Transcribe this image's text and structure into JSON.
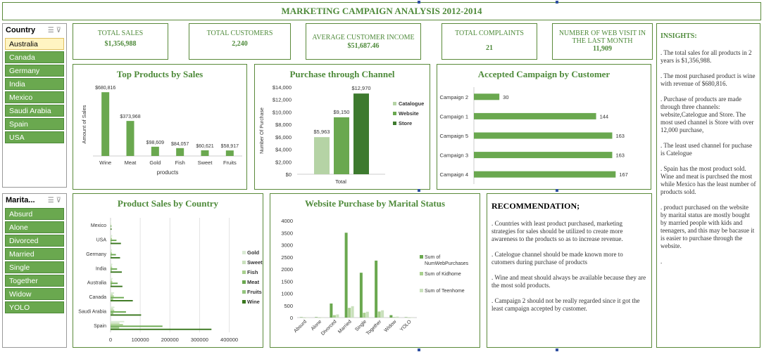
{
  "title": "MARKETING CAMPAIGN ANALYSIS 2012-2014",
  "kpis": [
    {
      "label": "TOTAL SALES",
      "value": "$1,356,988"
    },
    {
      "label": "TOTAL CUSTOMERS",
      "value": "2,240"
    },
    {
      "label": "AVERAGE CUSTOMER INCOME",
      "value": "$51,687.46"
    },
    {
      "label": "TOTAL COMPLAINTS",
      "value": "21"
    },
    {
      "label": "NUMBER OF WEB VISIT IN THE LAST MONTH",
      "value": "11,909"
    }
  ],
  "country_slicer": {
    "header": "Country",
    "items": [
      "Australia",
      "Canada",
      "Germany",
      "India",
      "Mexico",
      "Saudi Arabia",
      "Spain",
      "USA"
    ],
    "selected": "Australia"
  },
  "marital_slicer": {
    "header": "Marita...",
    "items": [
      "Absurd",
      "Alone",
      "Divorced",
      "Married",
      "Single",
      "Together",
      "Widow",
      "YOLO"
    ]
  },
  "insights": {
    "heading": "INSIGHTS:",
    "paragraphs": [
      ". The total sales for all products in 2 years is $1,356,988.",
      ". The most purchased product is wine with revenue of $680,816.",
      ". Purchase of products are made through three channels: website,Catelogue and Store. The most used channel is Store with over 12,000 purchase,",
      ". The least used channel for puchase is Catelogue",
      ". Spain has the most product sold. Wine and meat is purchsed the most while Mexico has the least number of products sold.",
      ". product purchased on the website by marital status are mostly bought by married people with kids and teenagers, and this may be bacasue it is easier to purchase through the website.",
      "."
    ]
  },
  "recommendation": {
    "heading": "RECOMMENDATION;",
    "paragraphs": [
      ". Countries with least product purchased, marketing strategies for sales should be utilized to create more awareness to the products so as to increase revenue.",
      ". Catelogue channel should be made known more to cutomers during purchase of products",
      ". Wine and meat should always be available because they are the most sold products.",
      ". Campaign 2 should not be really regarded since it got the least campaign accepted by customer."
    ]
  },
  "colors": {
    "accent": "#4e8a3a",
    "bar": "#6aa84f",
    "dark": "#3d7a2e",
    "light": "#b5d3a5"
  },
  "chart_data": [
    {
      "type": "bar",
      "title": "Top Products by Sales",
      "categories": [
        "Wine",
        "Meat",
        "Gold",
        "Fish",
        "Sweet",
        "Fruits"
      ],
      "values": [
        680816,
        373968,
        98609,
        84057,
        60621,
        58917
      ],
      "value_labels": [
        "$680,816",
        "$373,968",
        "$98,609",
        "$84,057",
        "$60,621",
        "$58,917"
      ],
      "xlabel": "products",
      "ylabel": "Amount of Sales",
      "ylim": [
        0,
        750000
      ]
    },
    {
      "type": "bar",
      "title": "Purchase through Channel",
      "categories": [
        "Total"
      ],
      "series": [
        {
          "name": "Catalogue",
          "values": [
            5963
          ],
          "label": "$5,963"
        },
        {
          "name": "Website",
          "values": [
            9150
          ],
          "label": "$9,150"
        },
        {
          "name": "Store",
          "values": [
            12970
          ],
          "label": "$12,970"
        }
      ],
      "ylabel": "Number Of Purchase",
      "yticks": [
        "$0",
        "$2,000",
        "$4,000",
        "$6,000",
        "$8,000",
        "$10,000",
        "$12,000",
        "$14,000"
      ],
      "ylim": [
        0,
        14000
      ]
    },
    {
      "type": "bar",
      "orientation": "horizontal",
      "title": "Accepted Campaign by Customer",
      "categories": [
        "Campaign 2",
        "Campaign 1",
        "Campaign 5",
        "Campaign 3",
        "Campaign 4"
      ],
      "values": [
        30,
        144,
        163,
        163,
        167
      ],
      "xlim": [
        0,
        185
      ]
    },
    {
      "type": "bar",
      "orientation": "horizontal",
      "title": "Product Sales by Country",
      "categories": [
        "Mexico",
        "USA",
        "Germany",
        "India",
        "Australia",
        "Canada",
        "Saudi Arabia",
        "Spain"
      ],
      "series": [
        {
          "name": "Gold",
          "values": [
            500,
            5500,
            4800,
            6000,
            6500,
            12000,
            13000,
            46000
          ]
        },
        {
          "name": "Sweet",
          "values": [
            300,
            3500,
            3000,
            4000,
            4500,
            8000,
            9000,
            30000
          ]
        },
        {
          "name": "Fish",
          "values": [
            400,
            5000,
            4500,
            5500,
            6000,
            11000,
            12500,
            42000
          ]
        },
        {
          "name": "Meat",
          "values": [
            3000,
            20000,
            18000,
            22000,
            24000,
            45000,
            52000,
            175000
          ]
        },
        {
          "name": "Fruits",
          "values": [
            300,
            3500,
            3200,
            4200,
            4500,
            8500,
            9500,
            29000
          ]
        },
        {
          "name": "Wine",
          "values": [
            3500,
            35000,
            32000,
            38000,
            40000,
            75000,
            103000,
            340000
          ]
        }
      ],
      "xticks": [
        "0",
        "100000",
        "200000",
        "300000",
        "400000"
      ],
      "xlim": [
        0,
        420000
      ]
    },
    {
      "type": "bar",
      "title": "Website Purchase by Marital Status",
      "categories": [
        "Absurd",
        "Alone",
        "Divorced",
        "Married",
        "Single",
        "Together",
        "Widow",
        "YOLO"
      ],
      "series": [
        {
          "name": "Sum of NumWebPurchases",
          "values": [
            15,
            18,
            580,
            3500,
            1850,
            2350,
            100,
            15
          ]
        },
        {
          "name": "Sum of Kidhome",
          "values": [
            0,
            2,
            100,
            400,
            200,
            250,
            20,
            0
          ]
        },
        {
          "name": "Sum of Teenhome",
          "values": [
            0,
            2,
            130,
            470,
            240,
            300,
            40,
            2
          ]
        }
      ],
      "yticks": [
        "0",
        "500",
        "1000",
        "1500",
        "2000",
        "2500",
        "3000",
        "3500",
        "4000"
      ],
      "ylim": [
        0,
        4000
      ]
    }
  ]
}
